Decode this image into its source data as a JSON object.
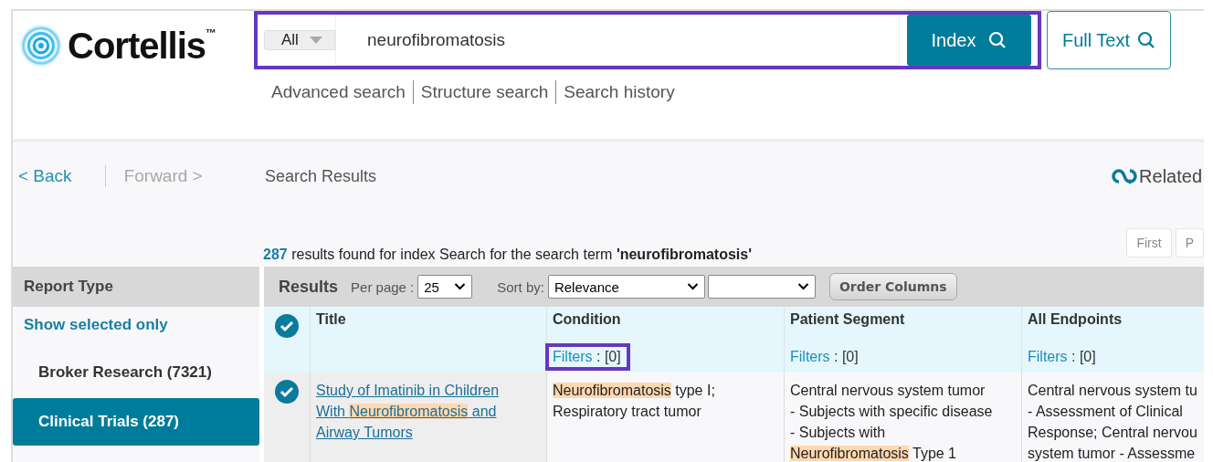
{
  "logo": {
    "text": "Cortellis",
    "mark": "™"
  },
  "search": {
    "scope": "All",
    "value": "neurofibromatosis",
    "outlined": true,
    "buttons": [
      {
        "label": "Index",
        "kind": "primary"
      },
      {
        "label": "Full Text",
        "kind": "outline"
      }
    ]
  },
  "search_links": [
    "Advanced search",
    "Structure search",
    "Search history"
  ],
  "nav": {
    "back": {
      "label": "< Back",
      "disabled": false
    },
    "forward": {
      "label": "Forward >",
      "disabled": true
    },
    "title": "Search Results",
    "related": "Related"
  },
  "results_summary": {
    "count": "287",
    "text": "results found for index Search for the search term **'neurofibromatosis'**"
  },
  "pagination": [
    "First",
    "P"
  ],
  "sidebar": {
    "heading": "Report Type",
    "show_selected": "Show selected only",
    "items": [
      {
        "label": "Broker Research (7321)",
        "selected": false
      },
      {
        "label": "Clinical Trials (287)",
        "selected": true
      }
    ]
  },
  "toolbar": {
    "title": "Results",
    "per_page_label": "Per page :",
    "per_page": "25",
    "sort_label": "Sort by:",
    "sort": "Relevance",
    "order_button": "Order Columns"
  },
  "table": {
    "header_checked": true,
    "columns": [
      {
        "label": "Title"
      },
      {
        "label": "Condition",
        "filter": {
          "label": "Filters",
          "count": ": [0]",
          "outlined": true
        }
      },
      {
        "label": "Patient Segment",
        "filter": {
          "label": "Filters",
          "count": ": [0]",
          "outlined": false
        }
      },
      {
        "label": "All Endpoints",
        "filter": {
          "label": "Filters",
          "count": ": [0]",
          "outlined": false
        }
      }
    ],
    "rows": [
      {
        "checked": true,
        "cells": [
          {
            "kind": "link",
            "lines": [
              [
                {
                  "text": "Study of Imatinib in Children",
                  "highlight": false
                }
              ],
              [
                {
                  "text": "With ",
                  "highlight": false
                },
                {
                  "text": "Neurofibromatosis",
                  "highlight": true
                },
                {
                  "text": " and",
                  "highlight": false
                }
              ],
              [
                {
                  "text": "Airway Tumors",
                  "highlight": false
                }
              ]
            ]
          },
          {
            "kind": "text",
            "lines": [
              [
                {
                  "text": "Neurofibromatosis",
                  "highlight": true
                },
                {
                  "text": " type I;",
                  "highlight": false
                }
              ],
              [
                {
                  "text": "Respiratory tract tumor",
                  "highlight": false
                }
              ]
            ]
          },
          {
            "kind": "text",
            "lines": [
              [
                {
                  "text": "Central nervous system tumor",
                  "highlight": false
                }
              ],
              [
                {
                  "text": "- Subjects with specific disease",
                  "highlight": false
                }
              ],
              [
                {
                  "text": "- Subjects with",
                  "highlight": false
                }
              ],
              [
                {
                  "text": "Neurofibromatosis",
                  "highlight": true
                },
                {
                  "text": " Type 1",
                  "highlight": false
                }
              ]
            ]
          },
          {
            "kind": "text",
            "lines": [
              [
                {
                  "text": "Central nervous system tu",
                  "highlight": false
                }
              ],
              [
                {
                  "text": "- Assessment of Clinical",
                  "highlight": false
                }
              ],
              [
                {
                  "text": "Response; Central nervou",
                  "highlight": false
                }
              ],
              [
                {
                  "text": "system tumor - Assessme",
                  "highlight": false
                }
              ]
            ]
          }
        ]
      }
    ]
  }
}
